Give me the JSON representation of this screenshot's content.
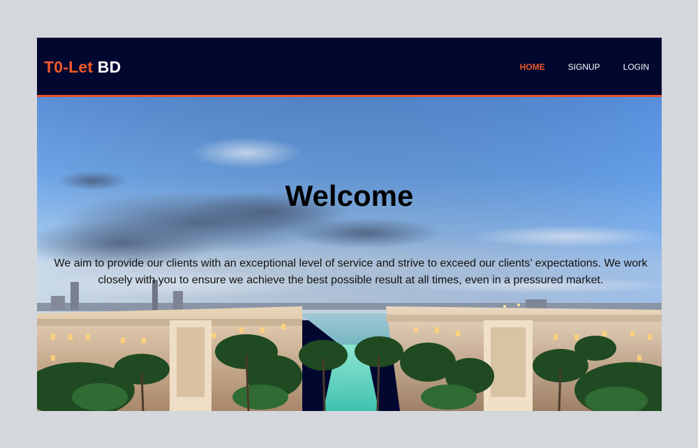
{
  "brand": {
    "logo_part1": "T0-Let",
    "logo_part2": "BD",
    "accent_color": "#f05a28",
    "nav_background": "#020730"
  },
  "nav": {
    "items": [
      {
        "label": "HOME",
        "active": true
      },
      {
        "label": "SIGNUP",
        "active": false
      },
      {
        "label": "LOGIN",
        "active": false
      }
    ]
  },
  "hero": {
    "title": "Welcome",
    "description": "We aim to provide our clients with an exceptional level of service and strive to exceed our clients’ expectations. We work closely with you to ensure we achieve the best possible result at all times, even in a pressured market.",
    "background": "resort-panorama-image"
  }
}
